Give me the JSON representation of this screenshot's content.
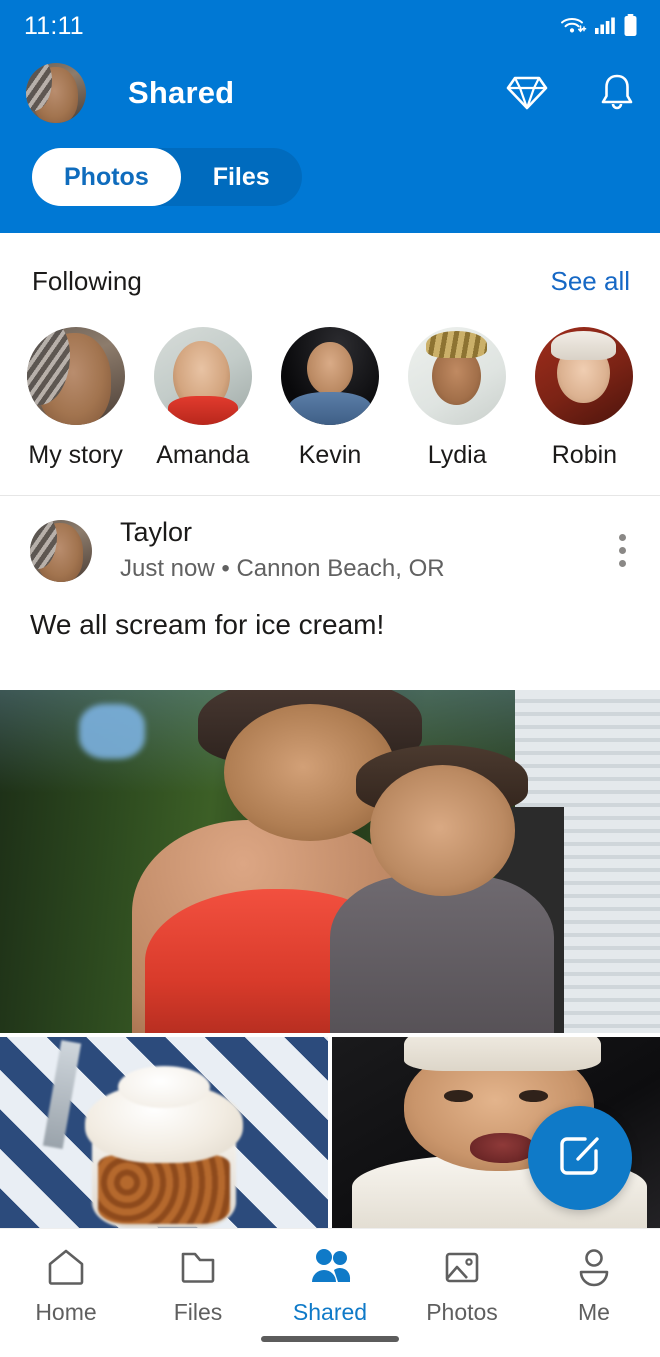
{
  "statusbar": {
    "time": "11:11",
    "icons": [
      "wifi-icon",
      "cellular-signal-icon",
      "battery-icon"
    ]
  },
  "header": {
    "title": "Shared",
    "accent_color": "#0078D4",
    "avatar_name": "user-avatar",
    "actions": [
      {
        "name": "premium-diamond-icon",
        "label": "Premium"
      },
      {
        "name": "notifications-bell-icon",
        "label": "Notifications"
      }
    ],
    "tabs": [
      {
        "label": "Photos",
        "active": true
      },
      {
        "label": "Files",
        "active": false
      }
    ]
  },
  "following": {
    "title": "Following",
    "see_all_label": "See all",
    "see_all_color": "#1668c5",
    "stories": [
      {
        "label": "My story",
        "avatar": "taylor"
      },
      {
        "label": "Amanda",
        "avatar": "amanda"
      },
      {
        "label": "Kevin",
        "avatar": "kevin"
      },
      {
        "label": "Lydia",
        "avatar": "lydia"
      },
      {
        "label": "Robin",
        "avatar": "robin"
      }
    ]
  },
  "post": {
    "author": "Taylor",
    "subtitle": "Just now • Cannon Beach, OR",
    "caption": "We all scream for ice cream!",
    "more_menu_name": "post-overflow-menu"
  },
  "photos": [
    {
      "name": "photo-family-selfie",
      "position": "large-top"
    },
    {
      "name": "photo-ice-cream-sundae",
      "position": "bottom-left"
    },
    {
      "name": "photo-baby-smiling",
      "position": "bottom-right"
    }
  ],
  "fab": {
    "name": "compose-fab",
    "icon": "compose-edit-icon",
    "color": "#0f7ac8"
  },
  "bottomnav": {
    "active_color": "#0f7ac8",
    "items": [
      {
        "label": "Home",
        "icon": "home-icon",
        "active": false
      },
      {
        "label": "Files",
        "icon": "folder-icon",
        "active": false
      },
      {
        "label": "Shared",
        "icon": "people-icon",
        "active": true
      },
      {
        "label": "Photos",
        "icon": "image-icon",
        "active": false
      },
      {
        "label": "Me",
        "icon": "person-icon",
        "active": false
      }
    ]
  }
}
